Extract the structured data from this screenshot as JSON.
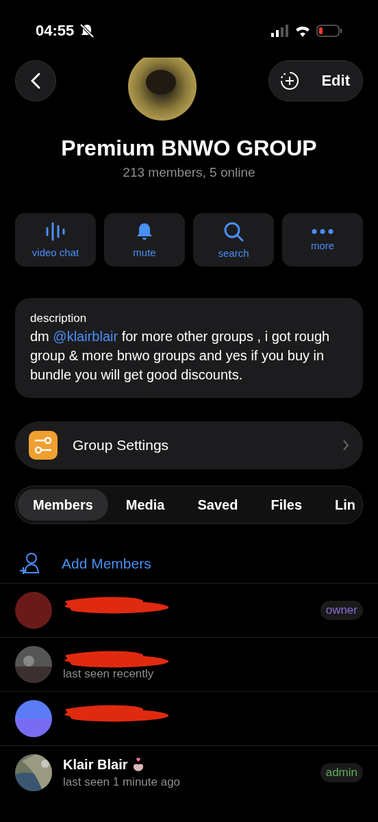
{
  "status_bar": {
    "time": "04:55",
    "silent": true
  },
  "header": {
    "edit_label": "Edit"
  },
  "group": {
    "title": "Premium BNWO GROUP",
    "subtitle": "213 members, 5 online"
  },
  "actions": [
    {
      "kind": "video",
      "label": "video chat"
    },
    {
      "kind": "bell",
      "label": "mute"
    },
    {
      "kind": "search",
      "label": "search"
    },
    {
      "kind": "more",
      "label": "more"
    }
  ],
  "description": {
    "heading": "description",
    "text_before": "dm ",
    "link": "@klairblair",
    "text_after": " for more other  groups , i got rough  group  & more bnwo groups and yes if you buy in bundle you will get good discounts."
  },
  "settings": {
    "label": "Group Settings"
  },
  "tabs": [
    {
      "label": "Members",
      "selected": true
    },
    {
      "label": "Media",
      "selected": false
    },
    {
      "label": "Saved",
      "selected": false
    },
    {
      "label": "Files",
      "selected": false
    },
    {
      "label": "Lin",
      "selected": false
    }
  ],
  "add_members": {
    "label": "Add Members"
  },
  "members": [
    {
      "kind": "redacted",
      "role": "owner",
      "color": "#8a6fd8"
    },
    {
      "kind": "redacted",
      "status": "last seen recently"
    },
    {
      "kind": "redacted"
    },
    {
      "kind": "named",
      "name": "Klair Blair",
      "status": "last seen 1 minute ago",
      "role": "admin",
      "color": "#5fae5a"
    }
  ]
}
